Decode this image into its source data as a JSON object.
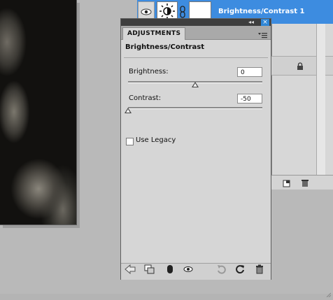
{
  "layers": {
    "layer_name": "Brightness/Contrast 1"
  },
  "adjustments_panel": {
    "tab_label": "ADJUSTMENTS",
    "close_glyph": "×",
    "collapse_glyph": "◂◂",
    "title": "Brightness/Contrast",
    "brightness": {
      "label": "Brightness:",
      "value": "0",
      "slider_fraction": 0.5
    },
    "contrast": {
      "label": "Contrast:",
      "value": "-50",
      "slider_fraction": 0.0
    },
    "use_legacy": {
      "label": "Use Legacy",
      "checked": false
    },
    "bottom_icons": [
      "back-arrow-icon",
      "clip-to-layer-icon",
      "view-previous-icon",
      "visibility-eye-icon",
      "reset-icon",
      "refresh-icon",
      "trash-icon"
    ]
  },
  "colors": {
    "selected_layer": "#3d8ce0",
    "panel_bg": "#d6d6d6",
    "title_bar": "#3e3e3e"
  }
}
